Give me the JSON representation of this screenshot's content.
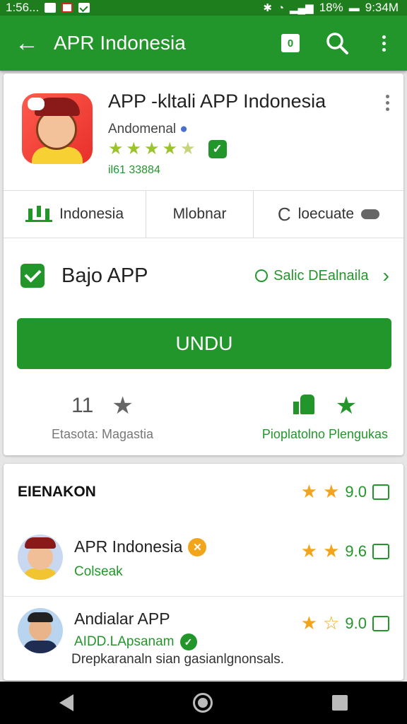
{
  "status_bar": {
    "left_text": "1:56...",
    "battery": "18%",
    "time": "9:34M"
  },
  "app_bar": {
    "title": "APR Indonesia",
    "tab_count": "0"
  },
  "app": {
    "name": "APP -kltali APP Indonesia",
    "developer": "Andomenal",
    "rating_stars": 4.5,
    "downloads": "il61 33884"
  },
  "segments": [
    {
      "label": "Indonesia"
    },
    {
      "label": "Mlobnar"
    },
    {
      "label": "loecuate"
    }
  ],
  "check_row": {
    "label": "Bajo APP",
    "link": "Salic DEalnaila"
  },
  "install_button": "UNDU",
  "stats": {
    "left_number": "11",
    "left_label": "Etasota: Magastia",
    "right_label": "Pioplatolno Plengukas"
  },
  "section": {
    "title": "EIENAKON",
    "top_rating": "9.0"
  },
  "list": [
    {
      "title": "APR Indonesia",
      "subtitle": "Colseak",
      "rating": "9.6"
    },
    {
      "title": "Andialar APP",
      "subtitle": "AIDD.LApsanam",
      "rating": "9.0",
      "description": "Drepkaranaln sian gasianlgnonsals."
    }
  ],
  "colors": {
    "primary_green": "#23962b",
    "star_gold": "#f2a51a"
  }
}
